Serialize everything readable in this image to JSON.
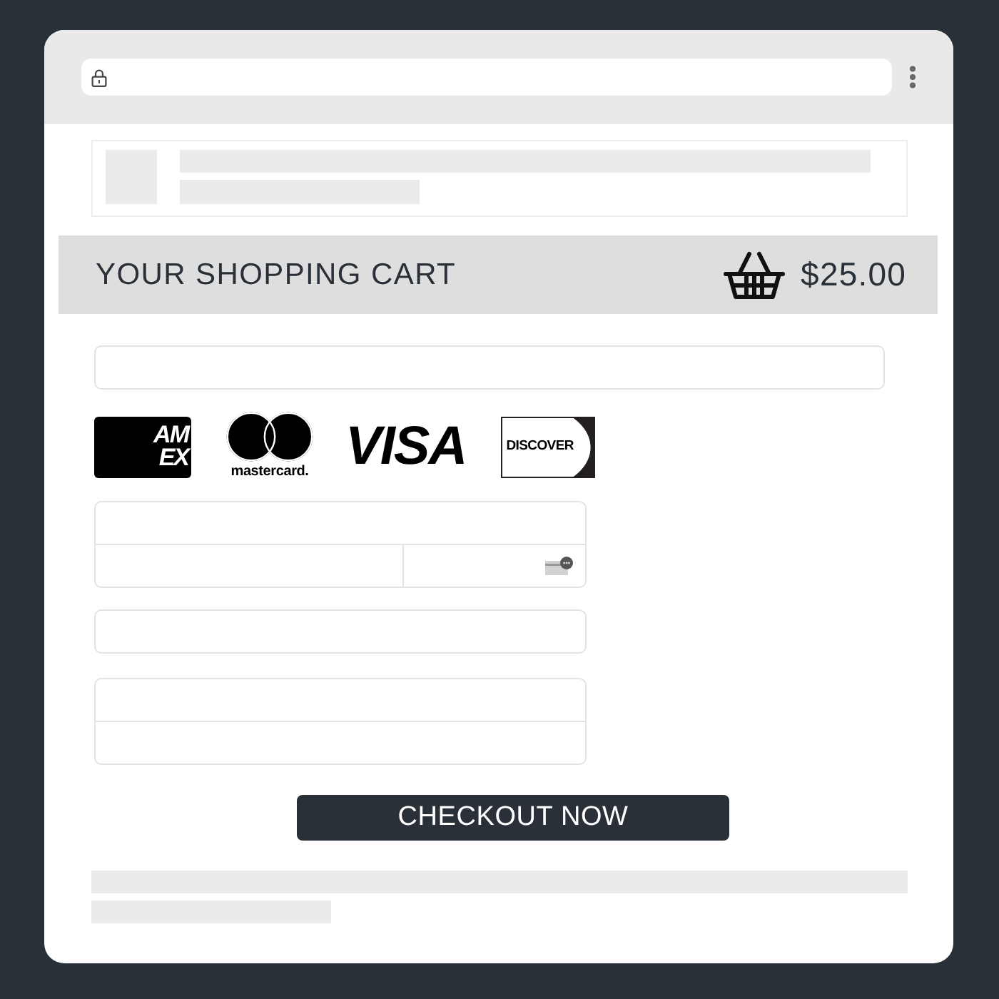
{
  "cart": {
    "title": "YOUR SHOPPING CART",
    "total": "$25.00"
  },
  "payment_logos": [
    {
      "kind": "amex",
      "lines": [
        "AM",
        "EX"
      ]
    },
    {
      "kind": "mastercard",
      "text": "mastercard."
    },
    {
      "kind": "visa",
      "text": "VISA"
    },
    {
      "kind": "discover",
      "text": "DISCOVER"
    }
  ],
  "checkout_button": {
    "label": "CHECKOUT NOW"
  }
}
